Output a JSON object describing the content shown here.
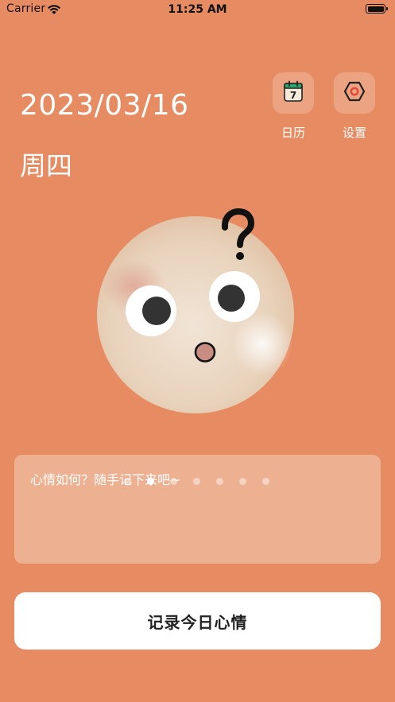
{
  "status_bar": {
    "carrier": "Carrier",
    "time": "11:25 AM"
  },
  "header": {
    "date": "2023/03/16",
    "weekday": "周四"
  },
  "toolbar": {
    "calendar": {
      "label": "日历",
      "icon": "calendar-icon",
      "day": "7"
    },
    "settings": {
      "label": "设置",
      "icon": "settings-icon"
    }
  },
  "mood": {
    "face": "confused-face",
    "mark": "?"
  },
  "note": {
    "placeholder": "心情如何？随手记下来吧~"
  },
  "pager": {
    "count": 7,
    "active_index": 1
  },
  "actions": {
    "record_label": "记录今日心情"
  },
  "colors": {
    "background": "#E78C62",
    "card": "#EDB091",
    "button": "#FFFFFF",
    "accent_red": "#E0473A",
    "calendar_green": "#2BA56B"
  }
}
